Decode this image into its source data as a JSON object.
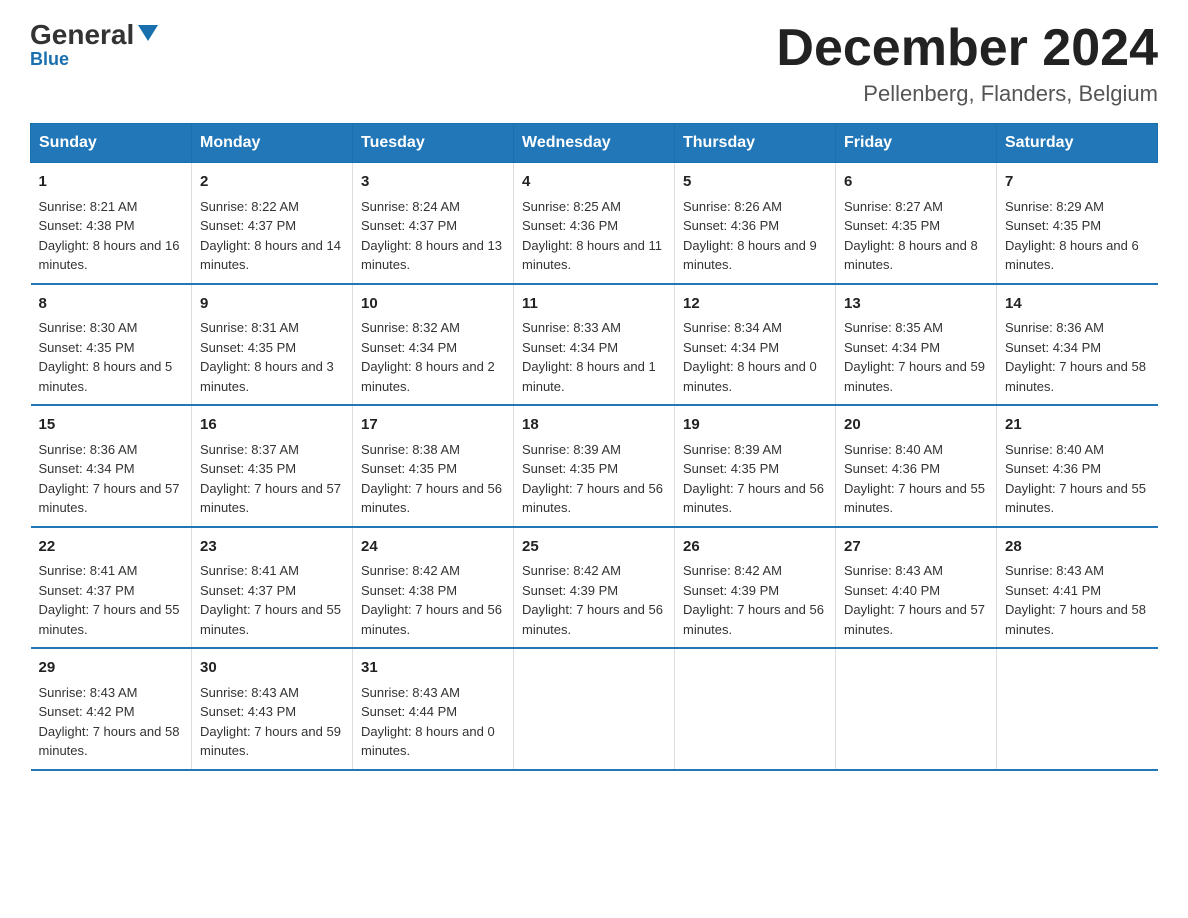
{
  "logo": {
    "general": "General",
    "triangle": "▲",
    "blue": "Blue"
  },
  "header": {
    "month_year": "December 2024",
    "location": "Pellenberg, Flanders, Belgium"
  },
  "days_of_week": [
    "Sunday",
    "Monday",
    "Tuesday",
    "Wednesday",
    "Thursday",
    "Friday",
    "Saturday"
  ],
  "weeks": [
    [
      {
        "day": "1",
        "sunrise": "8:21 AM",
        "sunset": "4:38 PM",
        "daylight": "8 hours and 16 minutes."
      },
      {
        "day": "2",
        "sunrise": "8:22 AM",
        "sunset": "4:37 PM",
        "daylight": "8 hours and 14 minutes."
      },
      {
        "day": "3",
        "sunrise": "8:24 AM",
        "sunset": "4:37 PM",
        "daylight": "8 hours and 13 minutes."
      },
      {
        "day": "4",
        "sunrise": "8:25 AM",
        "sunset": "4:36 PM",
        "daylight": "8 hours and 11 minutes."
      },
      {
        "day": "5",
        "sunrise": "8:26 AM",
        "sunset": "4:36 PM",
        "daylight": "8 hours and 9 minutes."
      },
      {
        "day": "6",
        "sunrise": "8:27 AM",
        "sunset": "4:35 PM",
        "daylight": "8 hours and 8 minutes."
      },
      {
        "day": "7",
        "sunrise": "8:29 AM",
        "sunset": "4:35 PM",
        "daylight": "8 hours and 6 minutes."
      }
    ],
    [
      {
        "day": "8",
        "sunrise": "8:30 AM",
        "sunset": "4:35 PM",
        "daylight": "8 hours and 5 minutes."
      },
      {
        "day": "9",
        "sunrise": "8:31 AM",
        "sunset": "4:35 PM",
        "daylight": "8 hours and 3 minutes."
      },
      {
        "day": "10",
        "sunrise": "8:32 AM",
        "sunset": "4:34 PM",
        "daylight": "8 hours and 2 minutes."
      },
      {
        "day": "11",
        "sunrise": "8:33 AM",
        "sunset": "4:34 PM",
        "daylight": "8 hours and 1 minute."
      },
      {
        "day": "12",
        "sunrise": "8:34 AM",
        "sunset": "4:34 PM",
        "daylight": "8 hours and 0 minutes."
      },
      {
        "day": "13",
        "sunrise": "8:35 AM",
        "sunset": "4:34 PM",
        "daylight": "7 hours and 59 minutes."
      },
      {
        "day": "14",
        "sunrise": "8:36 AM",
        "sunset": "4:34 PM",
        "daylight": "7 hours and 58 minutes."
      }
    ],
    [
      {
        "day": "15",
        "sunrise": "8:36 AM",
        "sunset": "4:34 PM",
        "daylight": "7 hours and 57 minutes."
      },
      {
        "day": "16",
        "sunrise": "8:37 AM",
        "sunset": "4:35 PM",
        "daylight": "7 hours and 57 minutes."
      },
      {
        "day": "17",
        "sunrise": "8:38 AM",
        "sunset": "4:35 PM",
        "daylight": "7 hours and 56 minutes."
      },
      {
        "day": "18",
        "sunrise": "8:39 AM",
        "sunset": "4:35 PM",
        "daylight": "7 hours and 56 minutes."
      },
      {
        "day": "19",
        "sunrise": "8:39 AM",
        "sunset": "4:35 PM",
        "daylight": "7 hours and 56 minutes."
      },
      {
        "day": "20",
        "sunrise": "8:40 AM",
        "sunset": "4:36 PM",
        "daylight": "7 hours and 55 minutes."
      },
      {
        "day": "21",
        "sunrise": "8:40 AM",
        "sunset": "4:36 PM",
        "daylight": "7 hours and 55 minutes."
      }
    ],
    [
      {
        "day": "22",
        "sunrise": "8:41 AM",
        "sunset": "4:37 PM",
        "daylight": "7 hours and 55 minutes."
      },
      {
        "day": "23",
        "sunrise": "8:41 AM",
        "sunset": "4:37 PM",
        "daylight": "7 hours and 55 minutes."
      },
      {
        "day": "24",
        "sunrise": "8:42 AM",
        "sunset": "4:38 PM",
        "daylight": "7 hours and 56 minutes."
      },
      {
        "day": "25",
        "sunrise": "8:42 AM",
        "sunset": "4:39 PM",
        "daylight": "7 hours and 56 minutes."
      },
      {
        "day": "26",
        "sunrise": "8:42 AM",
        "sunset": "4:39 PM",
        "daylight": "7 hours and 56 minutes."
      },
      {
        "day": "27",
        "sunrise": "8:43 AM",
        "sunset": "4:40 PM",
        "daylight": "7 hours and 57 minutes."
      },
      {
        "day": "28",
        "sunrise": "8:43 AM",
        "sunset": "4:41 PM",
        "daylight": "7 hours and 58 minutes."
      }
    ],
    [
      {
        "day": "29",
        "sunrise": "8:43 AM",
        "sunset": "4:42 PM",
        "daylight": "7 hours and 58 minutes."
      },
      {
        "day": "30",
        "sunrise": "8:43 AM",
        "sunset": "4:43 PM",
        "daylight": "7 hours and 59 minutes."
      },
      {
        "day": "31",
        "sunrise": "8:43 AM",
        "sunset": "4:44 PM",
        "daylight": "8 hours and 0 minutes."
      },
      null,
      null,
      null,
      null
    ]
  ]
}
